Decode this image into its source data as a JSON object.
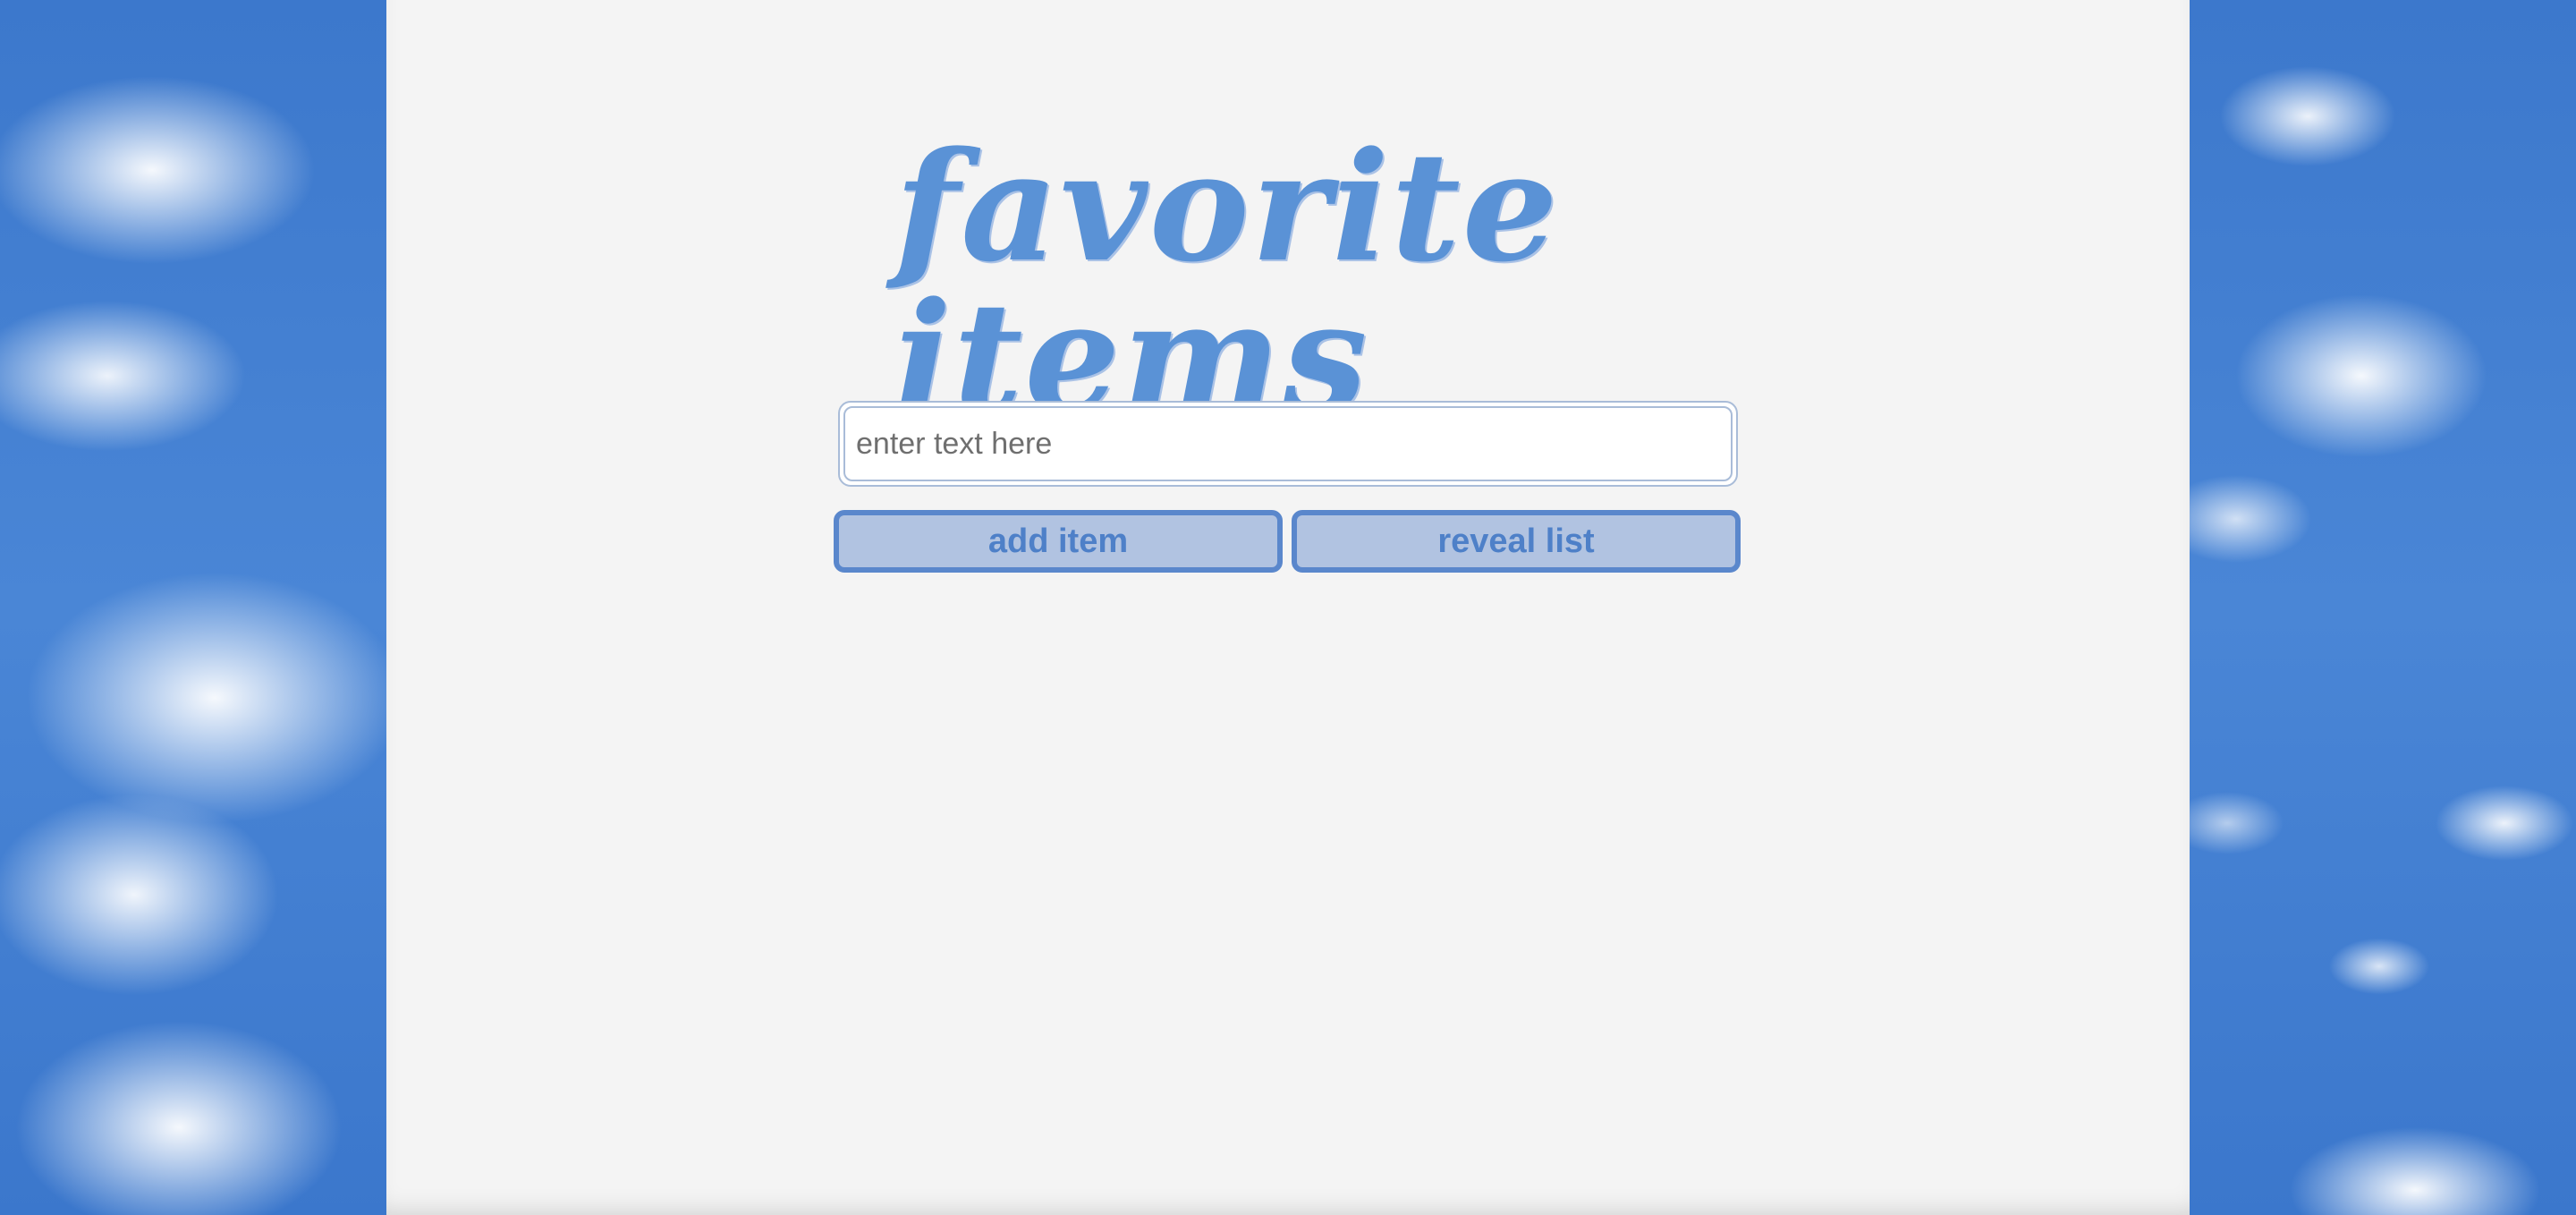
{
  "page": {
    "title": "favorite items"
  },
  "form": {
    "input_value": "",
    "input_placeholder": "enter text here",
    "add_label": "add item",
    "reveal_label": "reveal list"
  },
  "colors": {
    "accent": "#5a87cc",
    "button_fill": "#b1c3e1",
    "title": "#5a92d6",
    "panel": "#f4f4f4",
    "sky": "#3f7fd1"
  }
}
